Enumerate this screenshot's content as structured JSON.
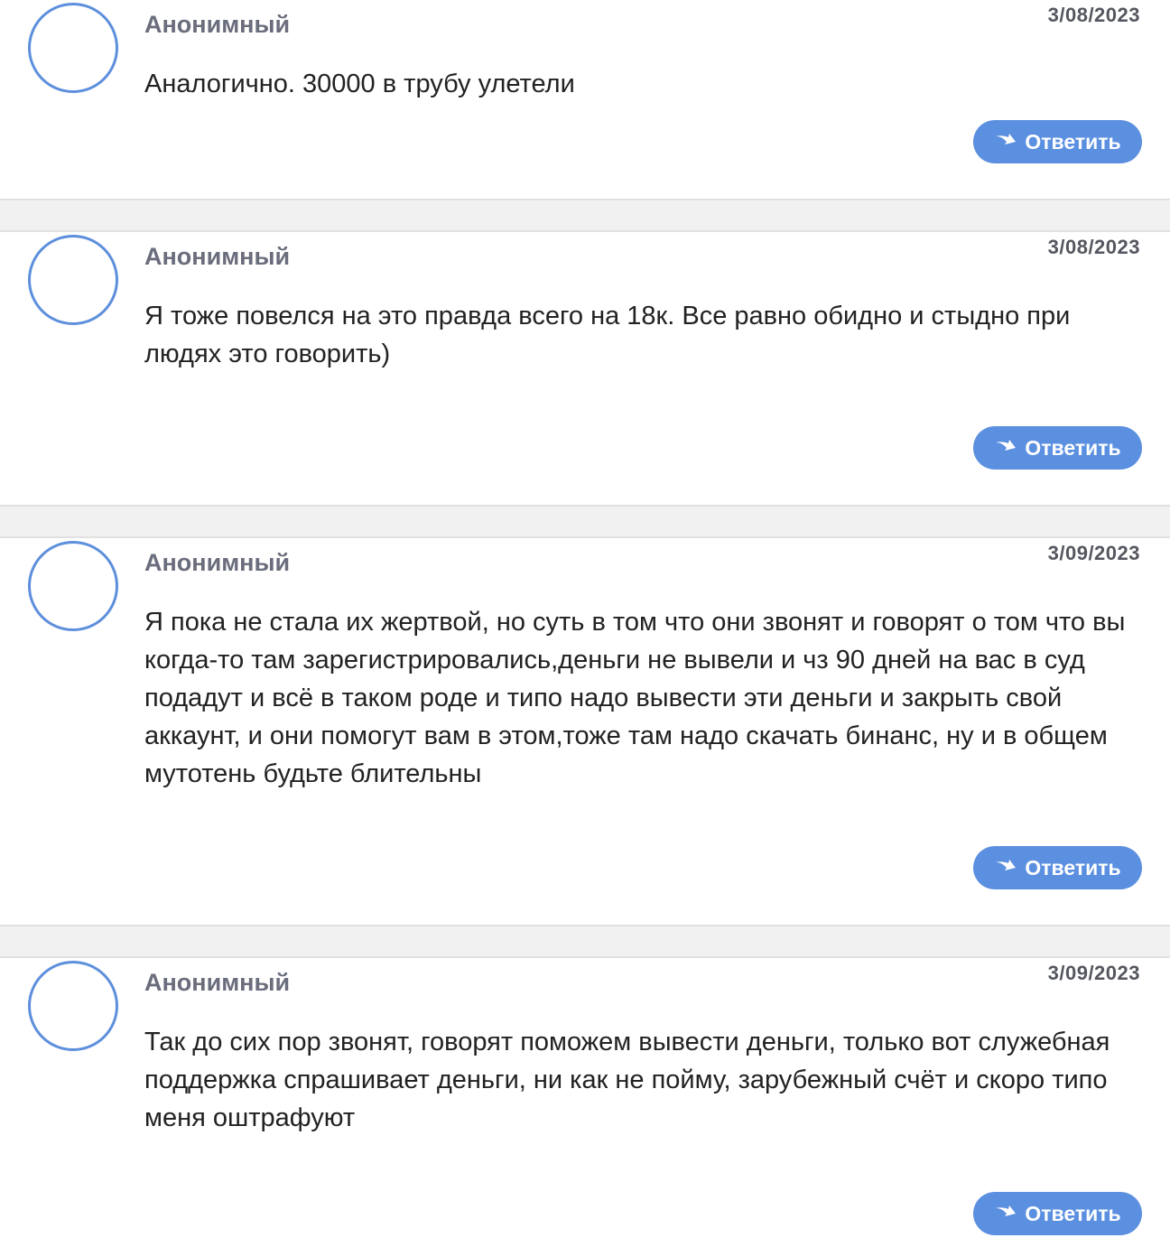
{
  "colors": {
    "accent": "#5b8fe0",
    "avatar_border": "#5d8fdc",
    "author_text": "#6a6d7c",
    "separator": "#f1f1f1"
  },
  "reply_icon": "reply-arrow-icon",
  "comments": [
    {
      "author": "Анонимный",
      "date": "3/08/2023",
      "text": "Аналогично. 30000 в трубу улетели",
      "reply_label": "Ответить"
    },
    {
      "author": "Анонимный",
      "date": "3/08/2023",
      "text": "Я тоже повелся на это правда всего на 18к. Все равно обидно и стыдно при людях это говорить)",
      "reply_label": "Ответить"
    },
    {
      "author": "Анонимный",
      "date": "3/09/2023",
      "text": "Я пока не стала их жертвой, но суть в том что они звонят и говорят о том что вы когда-то там зарегистрировались,деньги не вывели и чз 90 дней на вас в суд подадут и всё в таком роде и типо надо вывести эти деньги и закрыть свой аккаунт, и они помогут вам в этом,тоже там надо скачать бинанс, ну и в общем мутотень будьте блительны",
      "reply_label": "Ответить"
    },
    {
      "author": "Анонимный",
      "date": "3/09/2023",
      "text": "Так до сих пор звонят, говорят поможем вывести деньги, только вот служебная поддержка спрашивает деньги, ни как не пойму, зарубежный счёт и скоро типо меня оштрафуют",
      "reply_label": "Ответить"
    }
  ]
}
